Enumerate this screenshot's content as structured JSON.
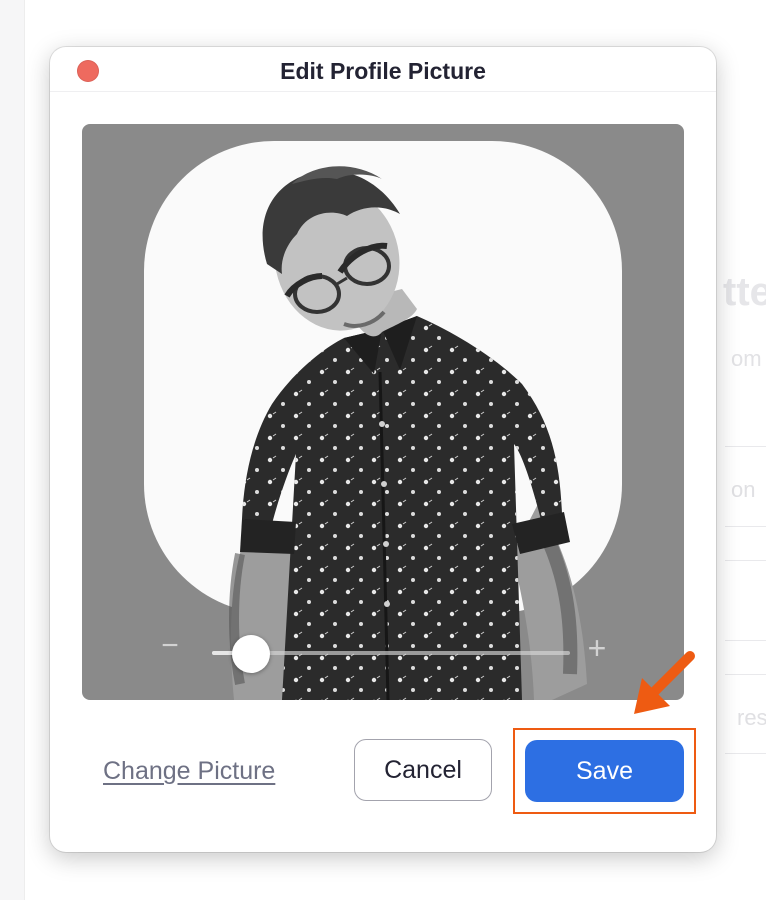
{
  "background_window": {
    "title_fragment": "tte",
    "subtitle_fragment": "om",
    "rows": [
      "",
      "on",
      "",
      "",
      "res"
    ]
  },
  "dialog": {
    "title": "Edit Profile Picture",
    "close_color": "#ee6a5f"
  },
  "editor": {
    "photo_description_icon": "person-photo",
    "zoom": {
      "minus_label": "−",
      "plus_label": "+",
      "level": 0.11
    }
  },
  "footer": {
    "change_picture_label": "Change Picture",
    "cancel_label": "Cancel",
    "save_label": "Save"
  },
  "colors": {
    "accent": "#2d6fe3",
    "annotation": "#ee5b12",
    "editor_background": "#8a8a8a"
  },
  "annotation": {
    "icon": "arrow-down-left-icon"
  }
}
